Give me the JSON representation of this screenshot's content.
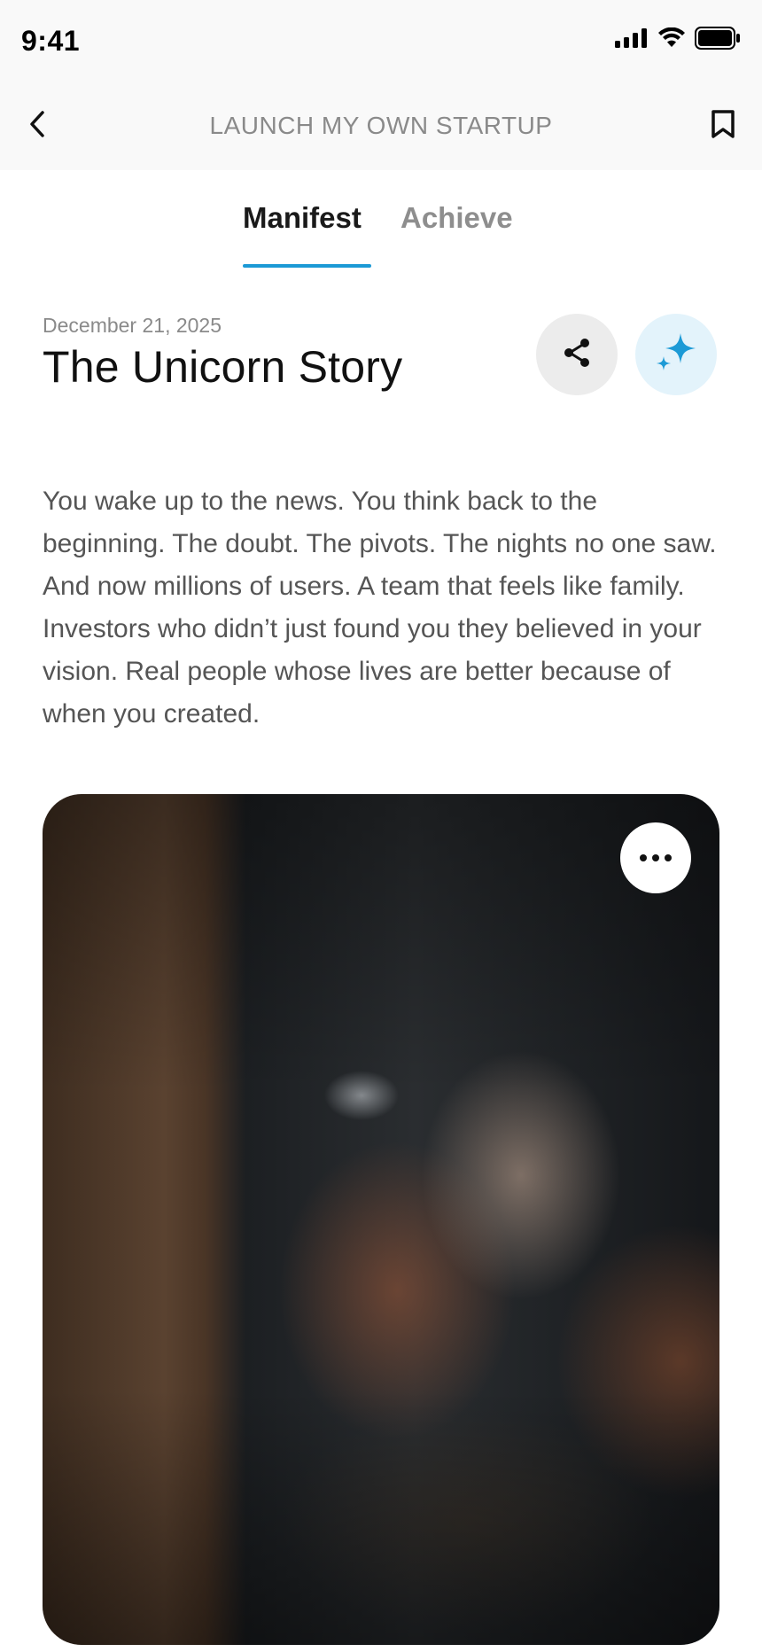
{
  "status_bar": {
    "time": "9:41",
    "icons": [
      "cellular-signal-icon",
      "wifi-icon",
      "battery-icon"
    ]
  },
  "nav": {
    "title": "LAUNCH MY OWN STARTUP",
    "back_icon": "chevron-left-icon",
    "bookmark_icon": "bookmark-icon"
  },
  "tabs": [
    {
      "label": "Manifest",
      "active": true
    },
    {
      "label": "Achieve",
      "active": false
    }
  ],
  "post": {
    "date": "December 21, 2025",
    "title": "The Unicorn Story",
    "body": "You wake up to the news. You think back to the beginning. The doubt. The pivots. The nights no one saw. And now millions of users. A team that feels like family. Investors who didn’t just found you they believed in your vision. Real people whose lives are better because of when you created.",
    "share_icon": "share-icon",
    "ai_icon": "sparkle-icon"
  },
  "photo": {
    "description_icon": "photo",
    "more_icon": "more-horizontal-icon"
  },
  "colors": {
    "accent": "#1c9ad6",
    "background": "#ffffff",
    "header_bg": "#f9f9f9",
    "muted_text": "#8a8a8a"
  }
}
